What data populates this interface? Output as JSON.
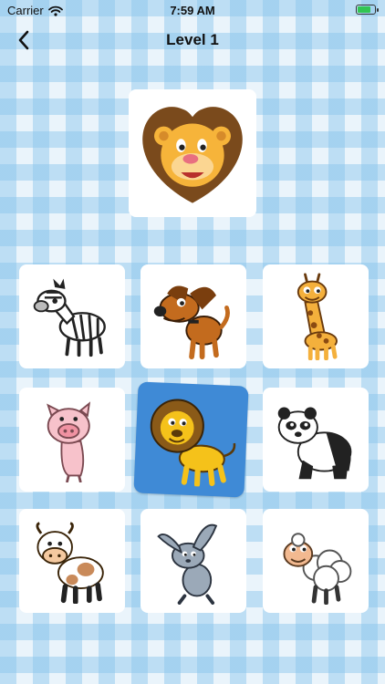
{
  "status_bar": {
    "carrier": "Carrier",
    "time": "7:59 AM",
    "battery_level": 0.85
  },
  "nav": {
    "title": "Level 1",
    "back_icon": "chevron-left-icon"
  },
  "target": {
    "animal": "lion",
    "icon": "lion-head-icon"
  },
  "grid": {
    "selected": "lion",
    "cards": [
      {
        "animal": "zebra"
      },
      {
        "animal": "dog"
      },
      {
        "animal": "giraffe"
      },
      {
        "animal": "pig"
      },
      {
        "animal": "lion"
      },
      {
        "animal": "panda"
      },
      {
        "animal": "cow"
      },
      {
        "animal": "rabbit"
      },
      {
        "animal": "sheep"
      }
    ]
  },
  "colors": {
    "accent": "#3f8ad6",
    "battery": "#32c552"
  }
}
